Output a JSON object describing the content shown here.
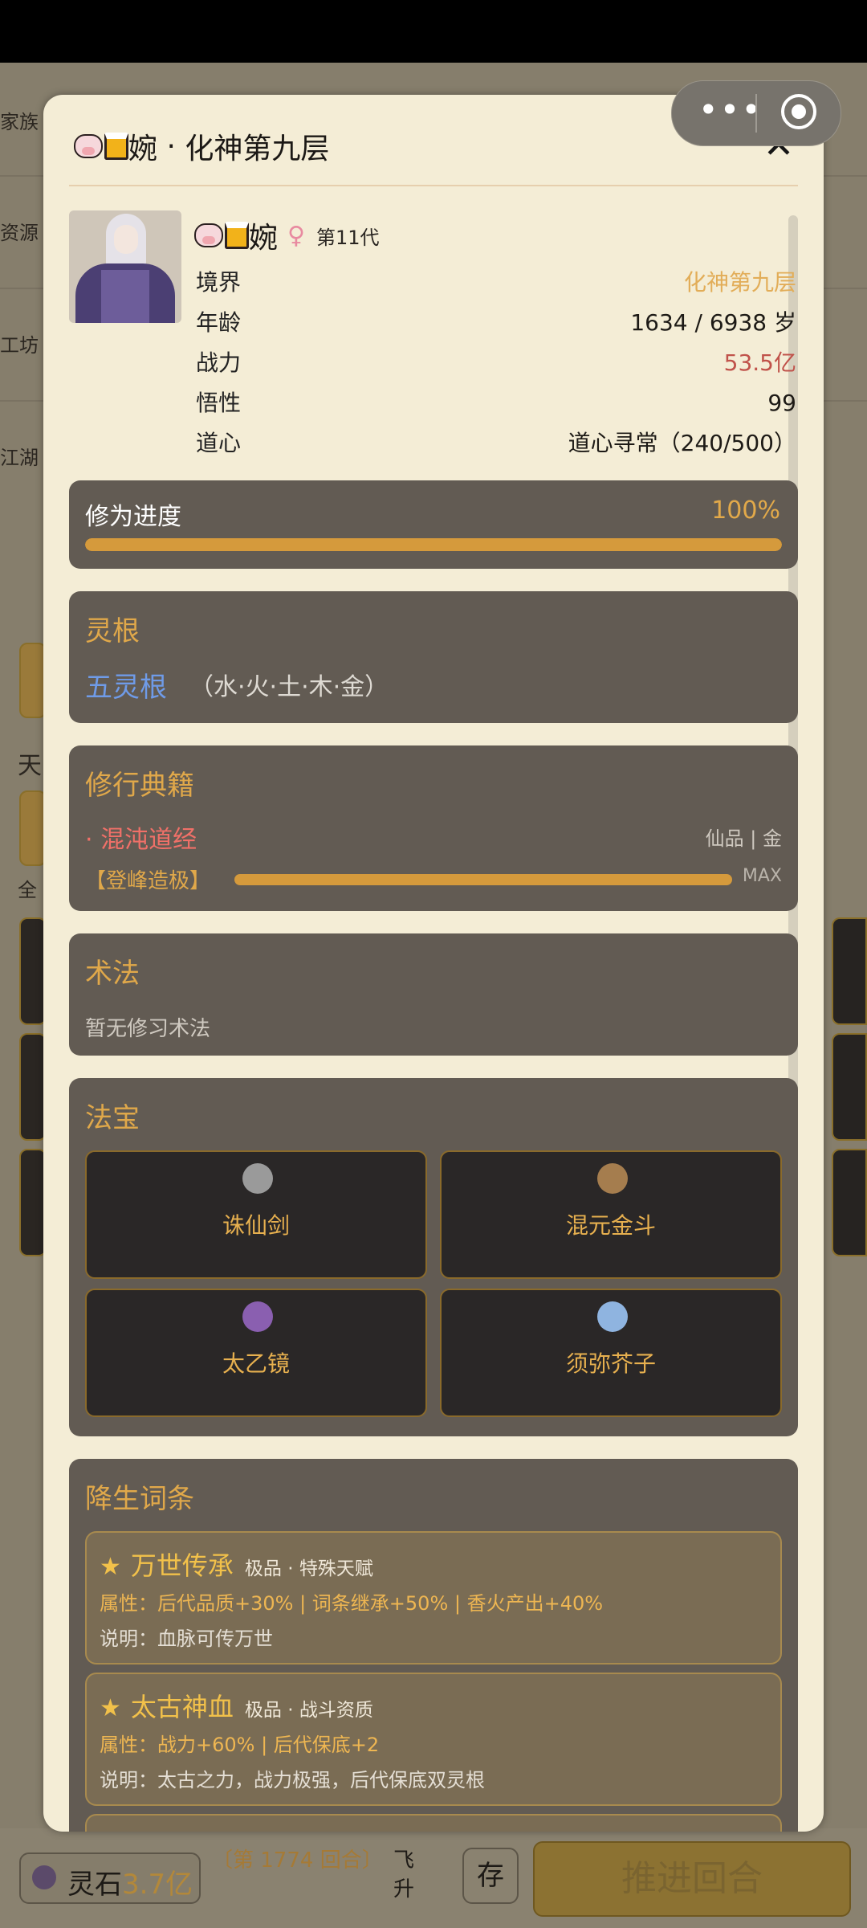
{
  "background": {
    "left_tabs": [
      "家族",
      "资源",
      "工坊",
      "江湖"
    ],
    "partial_letters": [
      "天",
      "全"
    ]
  },
  "bottom_bar": {
    "stone_label": "灵石",
    "stone_value": "3.7亿",
    "round_text": "〔第 1774 回合〕",
    "fly_text": "飞升",
    "save_label": "存",
    "advance_label": "推进回合"
  },
  "capsule": {
    "more": "•••"
  },
  "modal": {
    "title_name": "婉",
    "title_separator": " · ",
    "title_realm": "化神第九层",
    "close_icon": "✕",
    "profile": {
      "name": "婉",
      "gender_symbol": "♀",
      "generation": "第11代",
      "rows": [
        {
          "label": "境界",
          "value": "化神第九层",
          "color": "#e2ad58"
        },
        {
          "label": "年龄",
          "value": "1634 / 6938 岁",
          "color": "#1d1a16"
        },
        {
          "label": "战力",
          "value": "53.5亿",
          "color": "#c0524a"
        },
        {
          "label": "悟性",
          "value": "99",
          "color": "#1d1a16"
        },
        {
          "label": "道心",
          "value": "道心寻常（240/500）",
          "color": "#1d1a16"
        }
      ]
    },
    "cultivation": {
      "label": "修为进度",
      "percent_text": "100%",
      "progress": 1.0
    },
    "spirit_root": {
      "title": "灵根",
      "main": "五灵根",
      "elements": "（水·火·土·木·金）"
    },
    "books": {
      "title": "修行典籍",
      "name": "· 混沌道经",
      "grade": "仙品 | 金",
      "level": "【登峰造极】",
      "max": "MAX"
    },
    "spells": {
      "title": "术法",
      "empty": "暂无修习术法"
    },
    "treasures": {
      "title": "法宝",
      "items": [
        {
          "name": "诛仙剑",
          "icon": "sword-icon",
          "color": "#9a9a9a"
        },
        {
          "name": "混元金斗",
          "icon": "golden-bowl-icon",
          "color": "#a57d4e"
        },
        {
          "name": "太乙镜",
          "icon": "mirror-icon",
          "color": "#8a5fb0"
        },
        {
          "name": "须弥芥子",
          "icon": "swirl-icon",
          "color": "#8fb4e0"
        }
      ]
    },
    "traits": {
      "title": "降生词条",
      "items": [
        {
          "star": "★",
          "name": "万世传承",
          "grade": "极品 · 特殊天赋",
          "attr": "属性：后代品质+30% | 词条继承+50% | 香火产出+40%",
          "desc": "说明：血脉可传万世"
        },
        {
          "star": "★",
          "name": "太古神血",
          "grade": "极品 · 战斗资质",
          "attr": "属性：战力+60% | 后代保底+2",
          "desc": "说明：太古之力，战力极强，后代保底双灵根"
        }
      ]
    }
  }
}
